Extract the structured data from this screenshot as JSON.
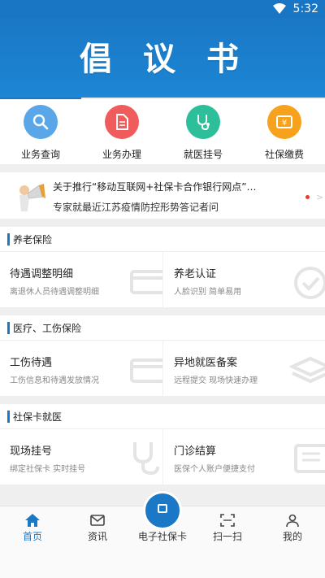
{
  "status_bar": {
    "time": "5:32"
  },
  "banner": {
    "title": "倡议书"
  },
  "quick_actions": [
    {
      "label": "业务查询",
      "icon": "search-icon",
      "color": "#59a6e8"
    },
    {
      "label": "业务办理",
      "icon": "document-icon",
      "color": "#f05b5b"
    },
    {
      "label": "就医挂号",
      "icon": "stethoscope-icon",
      "color": "#2cbf9a"
    },
    {
      "label": "社保缴费",
      "icon": "payment-icon",
      "color": "#f7a21d"
    }
  ],
  "news": {
    "line1": "关于推行“移动互联网+社保卡合作银行网点”…",
    "line2": "专家就最近江苏疫情防控形势答记者问"
  },
  "sections": [
    {
      "title": "养老保险",
      "cards": [
        {
          "title": "待遇调整明细",
          "subtitle": "离退休人员待遇调整明细",
          "icon": "card-icon"
        },
        {
          "title": "养老认证",
          "subtitle": "人脸识别 简单易用",
          "icon": "check-icon"
        }
      ]
    },
    {
      "title": "医疗、工伤保险",
      "cards": [
        {
          "title": "工伤待遇",
          "subtitle": "工伤信息和待遇发放情况",
          "icon": "card-icon"
        },
        {
          "title": "异地就医备案",
          "subtitle": "远程提交 现场快速办理",
          "icon": "layers-icon"
        }
      ]
    },
    {
      "title": "社保卡就医",
      "cards": [
        {
          "title": "现场挂号",
          "subtitle": "绑定社保卡 实时挂号",
          "icon": "stethoscope-icon"
        },
        {
          "title": "门诊结算",
          "subtitle": "医保个人账户便捷支付",
          "icon": "receipt-icon"
        }
      ]
    }
  ],
  "tabs": [
    {
      "label": "首页",
      "icon": "home-icon",
      "active": true
    },
    {
      "label": "资讯",
      "icon": "mail-icon",
      "active": false
    },
    {
      "label": "电子社保卡",
      "icon": "card-icon",
      "active": false
    },
    {
      "label": "扫一扫",
      "icon": "scan-icon",
      "active": false
    },
    {
      "label": "我的",
      "icon": "user-icon",
      "active": false
    }
  ],
  "colors": {
    "primary": "#1a78c6",
    "news_dot": "#e53935"
  }
}
